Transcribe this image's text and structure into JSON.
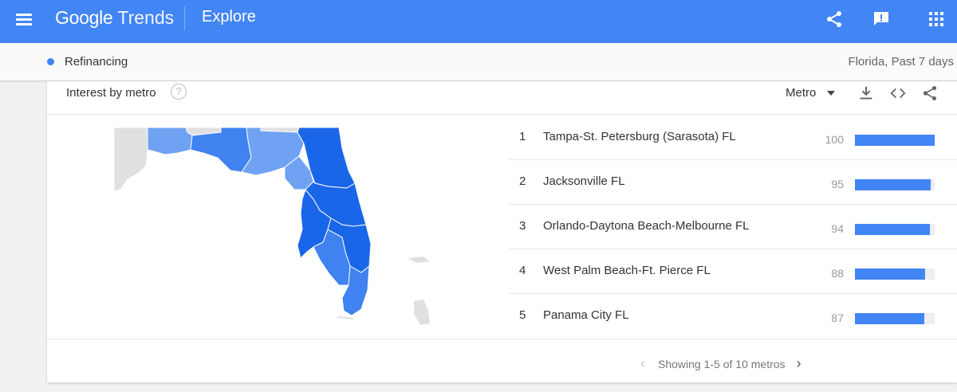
{
  "appbar": {
    "brand_google": "Google",
    "brand_trends": "Trends",
    "page": "Explore"
  },
  "term": {
    "name": "Refinancing",
    "color": "#4285f4",
    "context": "Florida, Past 7 days"
  },
  "card": {
    "title": "Interest by metro",
    "help_glyph": "?",
    "resolution": "Metro",
    "header_icons": [
      "download-icon",
      "embed-icon",
      "share-icon"
    ],
    "rows": [
      {
        "rank": "1",
        "name": "Tampa-St. Petersburg (Sarasota) FL",
        "score": 100
      },
      {
        "rank": "2",
        "name": "Jacksonville FL",
        "score": 95
      },
      {
        "rank": "3",
        "name": "Orlando-Daytona Beach-Melbourne FL",
        "score": 94
      },
      {
        "rank": "4",
        "name": "West Palm Beach-Ft. Pierce FL",
        "score": 88
      },
      {
        "rank": "5",
        "name": "Panama City FL",
        "score": 87
      }
    ],
    "pager": {
      "prev": "‹",
      "text": "Showing 1-5 of 10 metros",
      "next": "›"
    }
  },
  "colors": {
    "accent": "#4285f4",
    "map_dark": "#1a66e8",
    "map_mid": "#3f82f0",
    "map_light": "#6fa2f3",
    "map_none": "#e0e0e0"
  }
}
